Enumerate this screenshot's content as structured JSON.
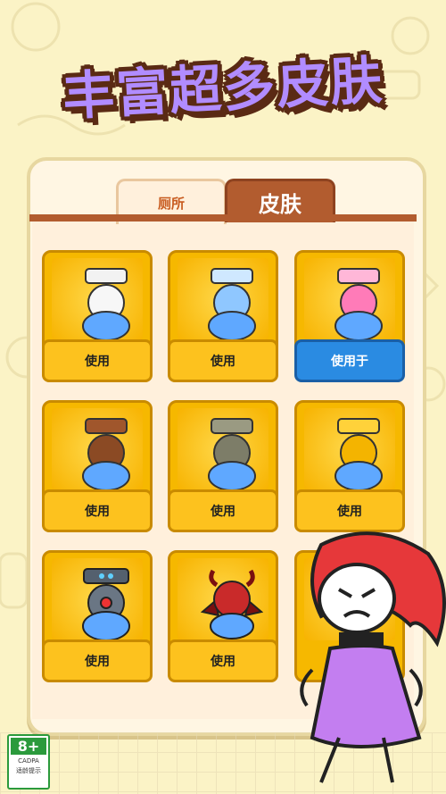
{
  "headline": "丰富超多皮肤",
  "tabs": [
    {
      "label": "厕所",
      "active": true
    },
    {
      "label": "皮肤",
      "active": false
    }
  ],
  "skins": [
    {
      "variant": "white",
      "button": "使用"
    },
    {
      "variant": "light-blue",
      "button": "使用"
    },
    {
      "variant": "pink",
      "button": "使用于",
      "selected": true
    },
    {
      "variant": "wood",
      "button": "使用"
    },
    {
      "variant": "stone",
      "button": "使用"
    },
    {
      "variant": "gold",
      "button": "使用"
    },
    {
      "variant": "robot",
      "button": "使用"
    },
    {
      "variant": "demon",
      "button": "使用"
    },
    {
      "variant": "hidden"
    }
  ],
  "age_badge": {
    "rating": "8+",
    "org": "CADPA",
    "note": "适龄提示"
  },
  "colors": {
    "headline": "#b18cff",
    "panel": "#fff6e3",
    "tab_active_text": "#c85b1f",
    "tab_inactive_bg": "#b25c2f",
    "card": "#f6b800",
    "selected_button": "#2a8be2"
  }
}
